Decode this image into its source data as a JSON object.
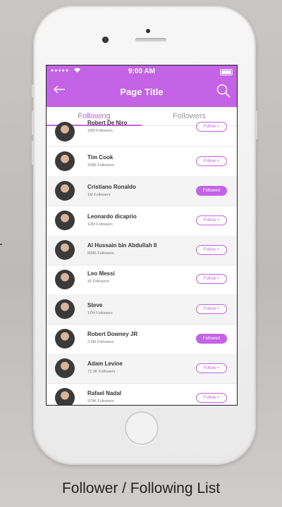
{
  "status_bar": {
    "signal": "●●●●●",
    "time": "9:00 AM"
  },
  "header": {
    "title": "Page Title"
  },
  "tabs": [
    {
      "label": "Following"
    },
    {
      "label": "Followers"
    }
  ],
  "rows": [
    {
      "name": "Robert De Niro",
      "followers": "33M Followers",
      "action": "Follow +"
    },
    {
      "name": "Tim Cook",
      "followers": "339K Followers",
      "action": "Follow +"
    },
    {
      "name": "Cristiano Ronaldo",
      "followers": "1M Followers",
      "action": "Followed"
    },
    {
      "name": "Leonardo dicaprio",
      "followers": "12M Followers",
      "action": "Follow +"
    },
    {
      "name": "Al Hussain bin Abdullah II",
      "followers": "999K Followers",
      "action": "Follow +"
    },
    {
      "name": "Leo Messi",
      "followers": "42 Followers",
      "action": "Follow +"
    },
    {
      "name": "Steve",
      "followers": "17M Followers",
      "action": "Follow +"
    },
    {
      "name": "Robert Downey JR",
      "followers": "2.3M Followers",
      "action": "Followed"
    },
    {
      "name": "Adam Levine",
      "followers": "72.3K Followers",
      "action": "Follow +"
    },
    {
      "name": "Rafael Nadal",
      "followers": "979K Followers",
      "action": "Follow +"
    }
  ],
  "caption": "Follower / Following List",
  "colors": {
    "accent": "#c563e6"
  }
}
